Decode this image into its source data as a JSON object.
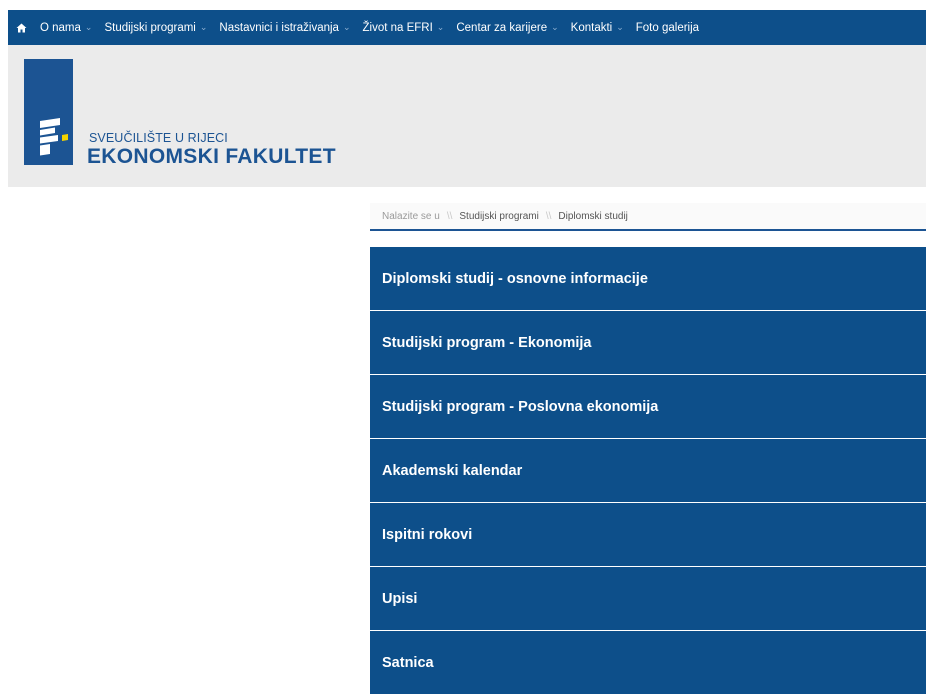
{
  "nav": {
    "home_icon": "home-icon",
    "items": [
      {
        "label": "O nama",
        "has_caret": true
      },
      {
        "label": "Studijski programi",
        "has_caret": true
      },
      {
        "label": "Nastavnici i istraživanja",
        "has_caret": true
      },
      {
        "label": "Život na EFRI",
        "has_caret": true
      },
      {
        "label": "Centar za karijere",
        "has_caret": true
      },
      {
        "label": "Kontakti",
        "has_caret": true
      },
      {
        "label": "Foto galerija",
        "has_caret": false
      }
    ],
    "caret_glyph": "⌄"
  },
  "header": {
    "university": "SVEUČILIŠTE U RIJECI",
    "faculty": "EKONOMSKI FAKULTET"
  },
  "breadcrumb": {
    "prefix": "Nalazite se u",
    "separator": "\\\\",
    "items": [
      "Studijski programi",
      "Diplomski studij"
    ]
  },
  "menu": {
    "items": [
      "Diplomski studij - osnovne informacije",
      "Studijski program - Ekonomija",
      "Studijski program - Poslovna ekonomija",
      "Akademski kalendar",
      "Ispitni rokovi",
      "Upisi",
      "Satnica"
    ]
  },
  "colors": {
    "primary": "#0d4f8a",
    "logo": "#1c5493",
    "header_bg": "#ebebeb",
    "logo_accent": "#f3d400"
  }
}
